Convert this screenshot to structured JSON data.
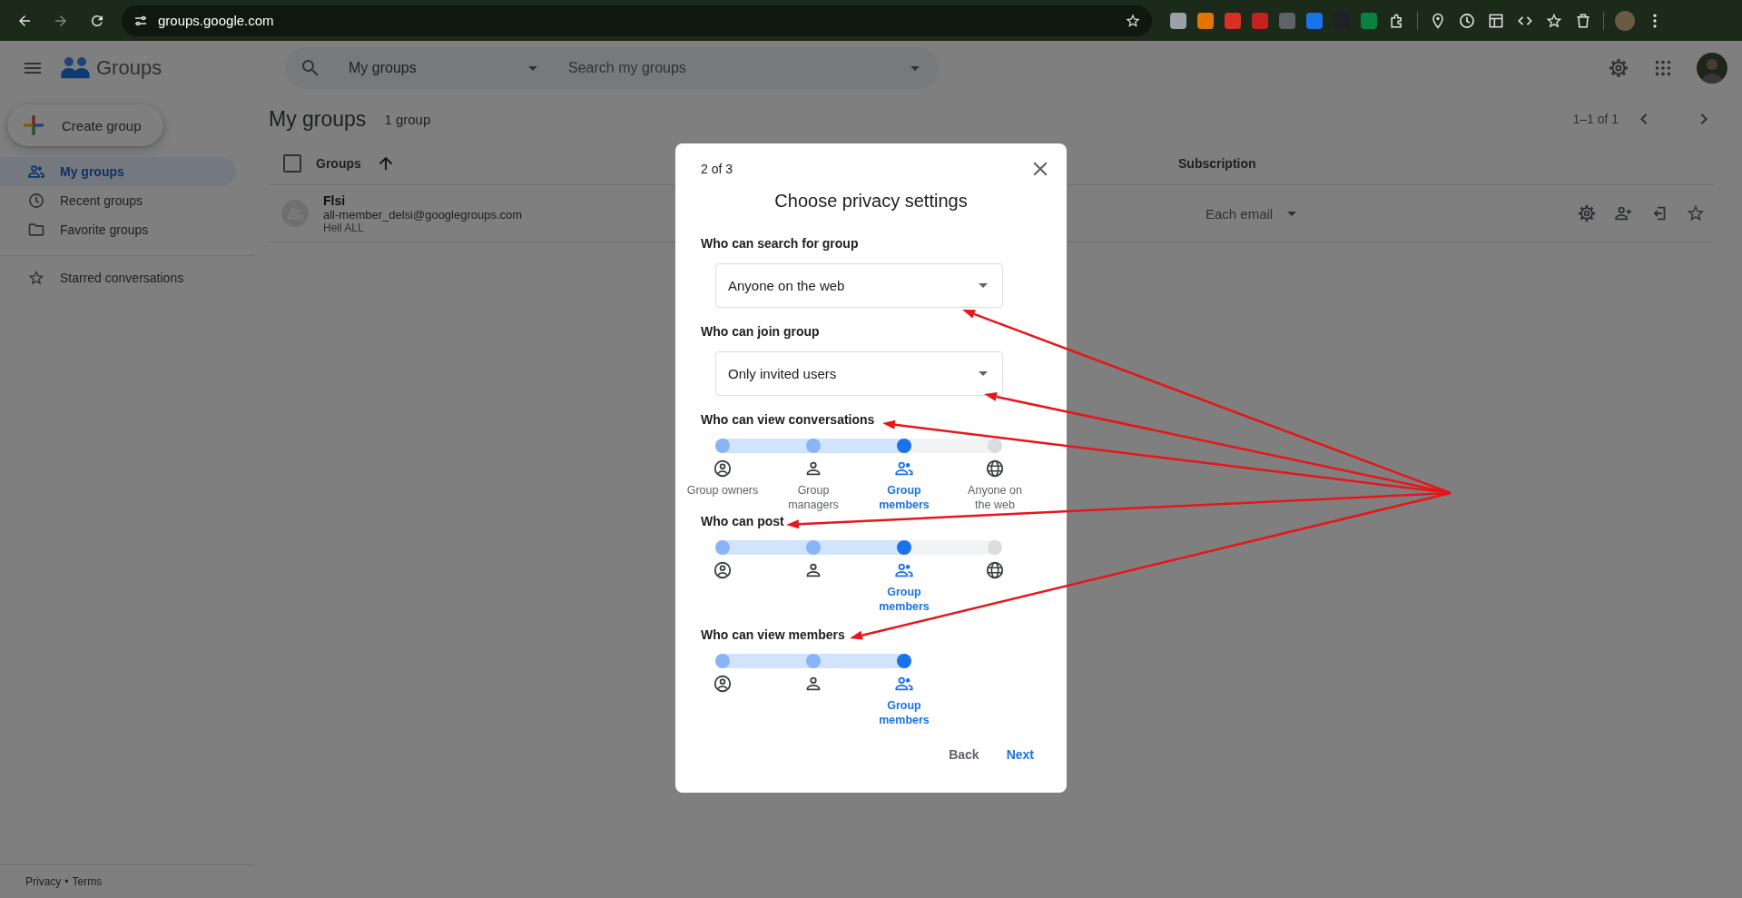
{
  "browser": {
    "url": "groups.google.com"
  },
  "app_bar": {
    "title": "Groups",
    "search": {
      "scope": "My groups",
      "placeholder": "Search my groups"
    }
  },
  "sidebar": {
    "create_button": "Create group",
    "items": [
      {
        "label": "My groups",
        "selected": true
      },
      {
        "label": "Recent groups",
        "selected": false
      },
      {
        "label": "Favorite groups",
        "selected": false
      }
    ],
    "extra_items": [
      {
        "label": "Starred conversations",
        "selected": false
      }
    ],
    "footer": {
      "links": [
        "Privacy",
        "Terms"
      ],
      "separator": "•"
    }
  },
  "content": {
    "title": "My groups",
    "count": "1 group",
    "pagination": "1–1 of 1",
    "select_all": {
      "checked": false
    },
    "columns": [
      {
        "label": "Groups"
      },
      {
        "label": "Subscription"
      }
    ],
    "rows": [
      {
        "name": "Flsi",
        "email": "all-member_delsi@googlegroups.com",
        "description": "Hell ALL",
        "subscription": "Each email"
      }
    ]
  },
  "dialog": {
    "step": "2 of 3",
    "title": "Choose privacy settings",
    "sections": [
      {
        "kind": "dropdown",
        "label": "Who can search for group",
        "value": "Anyone on the web"
      },
      {
        "kind": "dropdown",
        "label": "Who can join group",
        "value": "Only invited users"
      },
      {
        "kind": "slider",
        "label": "Who can view conversations",
        "options": [
          {
            "label": "Group owners",
            "selected": false
          },
          {
            "label": "Group managers",
            "selected": false
          },
          {
            "label": "Group members",
            "selected": true
          },
          {
            "label": "Anyone on the web",
            "selected": false
          }
        ]
      },
      {
        "kind": "slider",
        "label": "Who can post",
        "options": [
          {
            "selected": false
          },
          {
            "selected": false
          },
          {
            "label": "Group members",
            "selected": true
          },
          {
            "selected": false
          }
        ]
      },
      {
        "kind": "slider",
        "label": "Who can view members",
        "options": [
          {
            "selected": false
          },
          {
            "selected": false
          },
          {
            "label": "Group members",
            "selected": true
          }
        ]
      }
    ],
    "buttons": [
      {
        "label": "Back",
        "kind": "text"
      },
      {
        "label": "Next",
        "kind": "primary"
      }
    ]
  }
}
